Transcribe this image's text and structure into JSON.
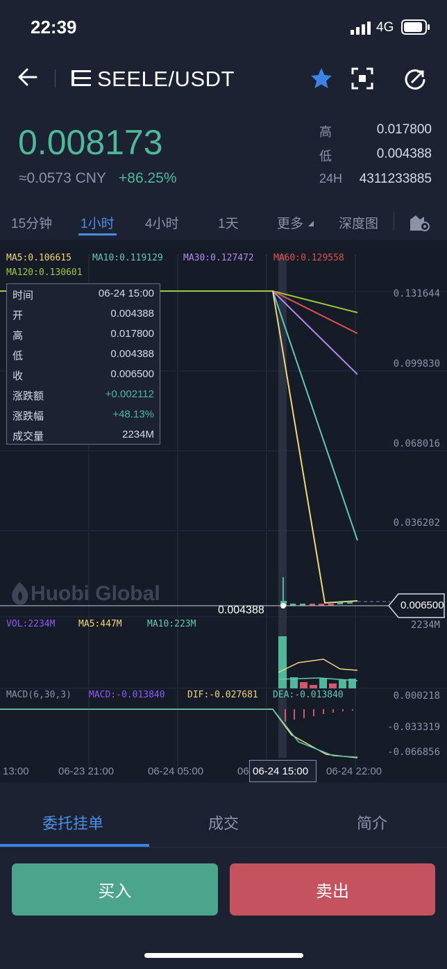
{
  "status_bar": {
    "time": "22:39",
    "network": "4G"
  },
  "header": {
    "pair": "SEELE/USDT"
  },
  "ticker": {
    "price": "0.008173",
    "cny": "≈0.0573 CNY",
    "change": "+86.25%",
    "high_label": "高",
    "high": "0.017800",
    "low_label": "低",
    "low": "0.004388",
    "vol_label": "24H",
    "vol": "4311233885"
  },
  "tabs": [
    "15分钟",
    "1小时",
    "4小时",
    "1天",
    "更多",
    "深度图"
  ],
  "ma": {
    "ma5": "MA5:0.106615",
    "ma10": "MA10:0.119129",
    "ma30": "MA30:0.127472",
    "ma60": "MA60:0.129558",
    "ma120": "MA120:0.130601"
  },
  "y_axis": [
    "0.131644",
    "0.099830",
    "0.068016",
    "0.036202"
  ],
  "tooltip": [
    {
      "k": "时间",
      "v": "06-24 15:00"
    },
    {
      "k": "开",
      "v": "0.004388"
    },
    {
      "k": "高",
      "v": "0.017800"
    },
    {
      "k": "低",
      "v": "0.004388"
    },
    {
      "k": "收",
      "v": "0.006500"
    },
    {
      "k": "涨跌额",
      "v": "+0.002112"
    },
    {
      "k": "涨跌幅",
      "v": "+48.13%"
    },
    {
      "k": "成交量",
      "v": "2234M"
    }
  ],
  "watermark": "Huobi Global",
  "low_marker": "0.004388",
  "current_price_tag": "0.006500",
  "volume": {
    "vol": "VOL:2234M",
    "ma5": "MA5:447M",
    "ma10": "MA10:223M",
    "axis": "2234M"
  },
  "macd": {
    "title": "MACD(6,30,3)",
    "macd": "MACD:-0.013840",
    "dif": "DIF:-0.027681",
    "dea": "DEA:-0.013840",
    "axis": [
      "0.000218",
      "-0.033319",
      "-0.066856"
    ]
  },
  "x_axis": [
    "13:00",
    "06-23 21:00",
    "06-24 05:00",
    "06",
    "06-24 15:00",
    "06-24 22:00"
  ],
  "bottom_tabs": [
    "委托挂单",
    "成交",
    "简介"
  ],
  "buttons": {
    "buy": "买入",
    "sell": "卖出"
  },
  "colors": {
    "up": "#4db89a",
    "down": "#d0586a",
    "accent": "#4a90e2"
  }
}
